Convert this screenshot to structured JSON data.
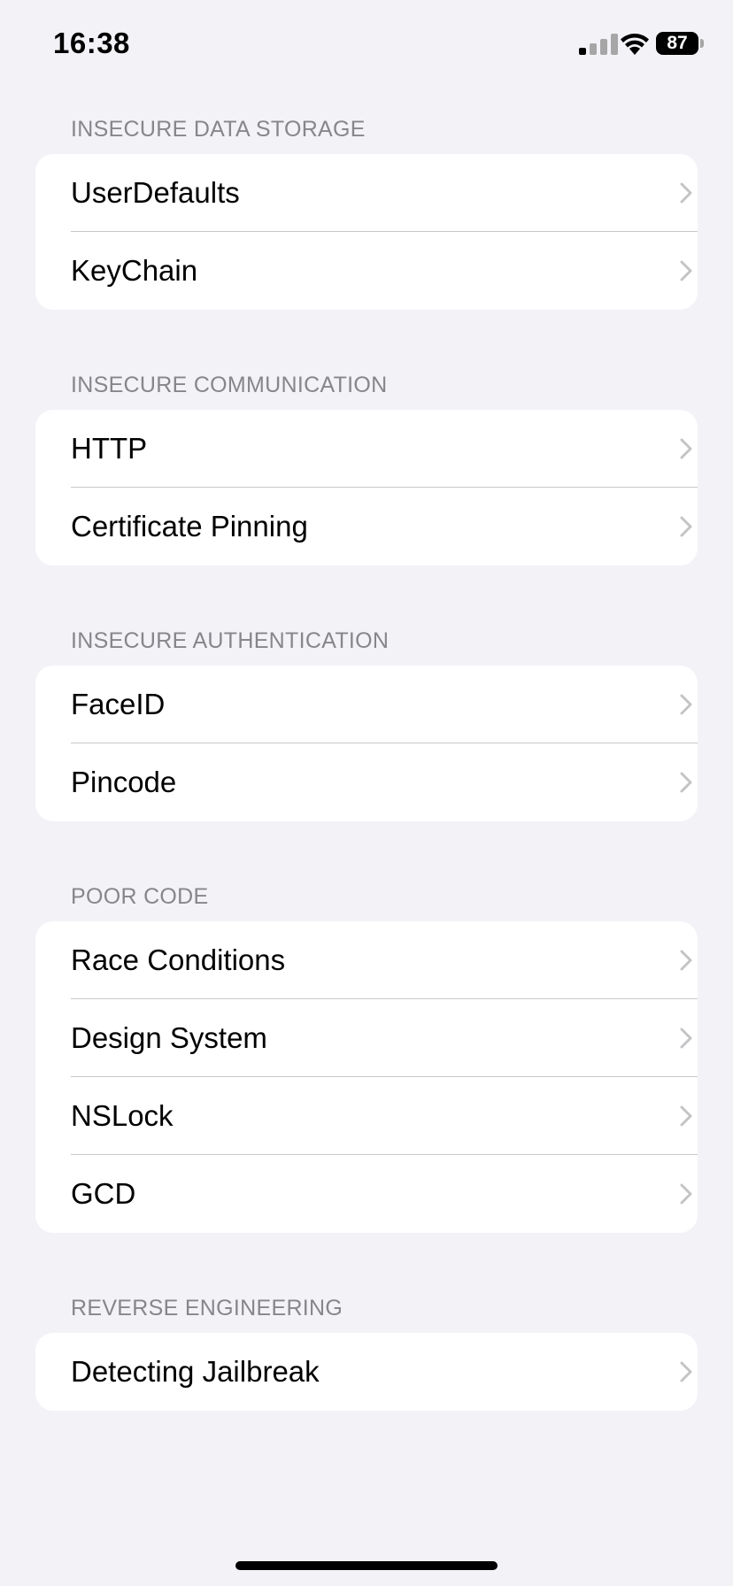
{
  "status_bar": {
    "time": "16:38",
    "battery": "87",
    "signal_icon": "cellular-signal-icon",
    "wifi_icon": "wifi-icon"
  },
  "sections": [
    {
      "header": "INSECURE DATA STORAGE",
      "items": [
        {
          "label": "UserDefaults"
        },
        {
          "label": "KeyChain"
        }
      ]
    },
    {
      "header": "INSECURE COMMUNICATION",
      "items": [
        {
          "label": "HTTP"
        },
        {
          "label": "Certificate Pinning"
        }
      ]
    },
    {
      "header": "INSECURE AUTHENTICATION",
      "items": [
        {
          "label": "FaceID"
        },
        {
          "label": "Pincode"
        }
      ]
    },
    {
      "header": "POOR CODE",
      "items": [
        {
          "label": "Race Conditions"
        },
        {
          "label": "Design System"
        },
        {
          "label": "NSLock"
        },
        {
          "label": "GCD"
        }
      ]
    },
    {
      "header": "REVERSE ENGINEERING",
      "items": [
        {
          "label": "Detecting Jailbreak"
        }
      ]
    }
  ]
}
